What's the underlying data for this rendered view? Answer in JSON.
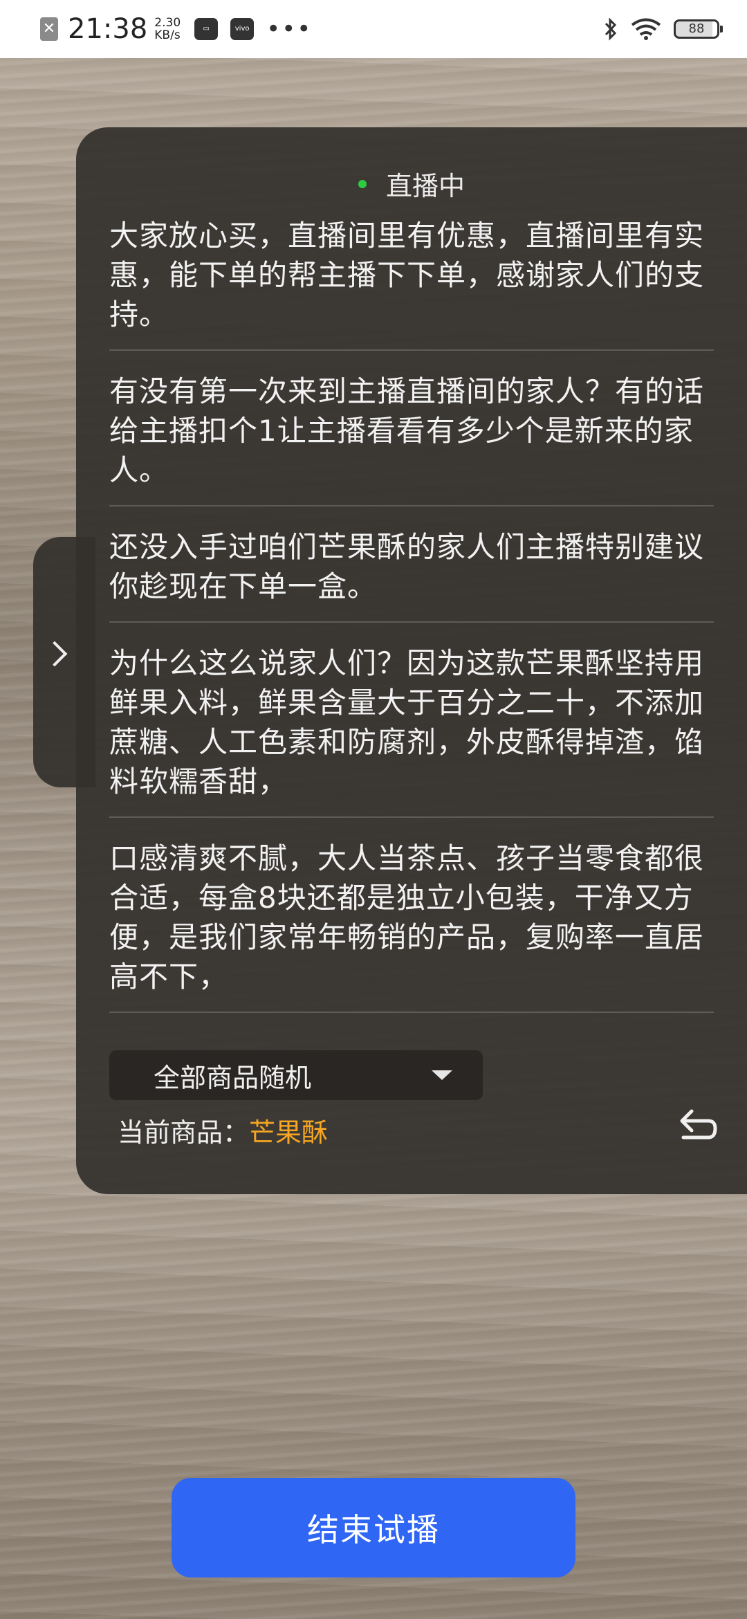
{
  "status_bar": {
    "time": "21:38",
    "net_speed_value": "2.30",
    "net_speed_unit": "KB/s",
    "battery": "88",
    "sim_icon": "x-box-icon",
    "icons": [
      "sim-disabled-icon",
      "card-icon",
      "vivo-icon",
      "more-dots-icon",
      "bluetooth-icon",
      "wifi-icon",
      "battery-icon"
    ]
  },
  "panel": {
    "live_status": "直播中",
    "scripts": [
      "大家放心买，直播间里有优惠，直播间里有实惠，能下单的帮主播下下单，感谢家人们的支持。",
      "有没有第一次来到主播直播间的家人？有的话给主播扣个1让主播看看有多少个是新来的家人。",
      "还没入手过咱们芒果酥的家人们主播特别建议你趁现在下单一盒。",
      "为什么这么说家人们？因为这款芒果酥坚持用鲜果入料，鲜果含量大于百分之二十，不添加蔗糖、人工色素和防腐剂，外皮酥得掉渣，馅料软糯香甜，",
      "口感清爽不腻，大人当茶点、孩子当零食都很合适，每盒8块还都是独立小包装，干净又方便，是我们家常年畅销的产品，复购率一直居高不下，"
    ],
    "product_mode": "全部商品随机",
    "current_label": "当前商品：",
    "current_value": "芒果酥"
  },
  "end_button": "结束试播",
  "colors": {
    "live_dot": "#2ecc40",
    "accent": "#f5a623",
    "button": "#2f66f4"
  }
}
